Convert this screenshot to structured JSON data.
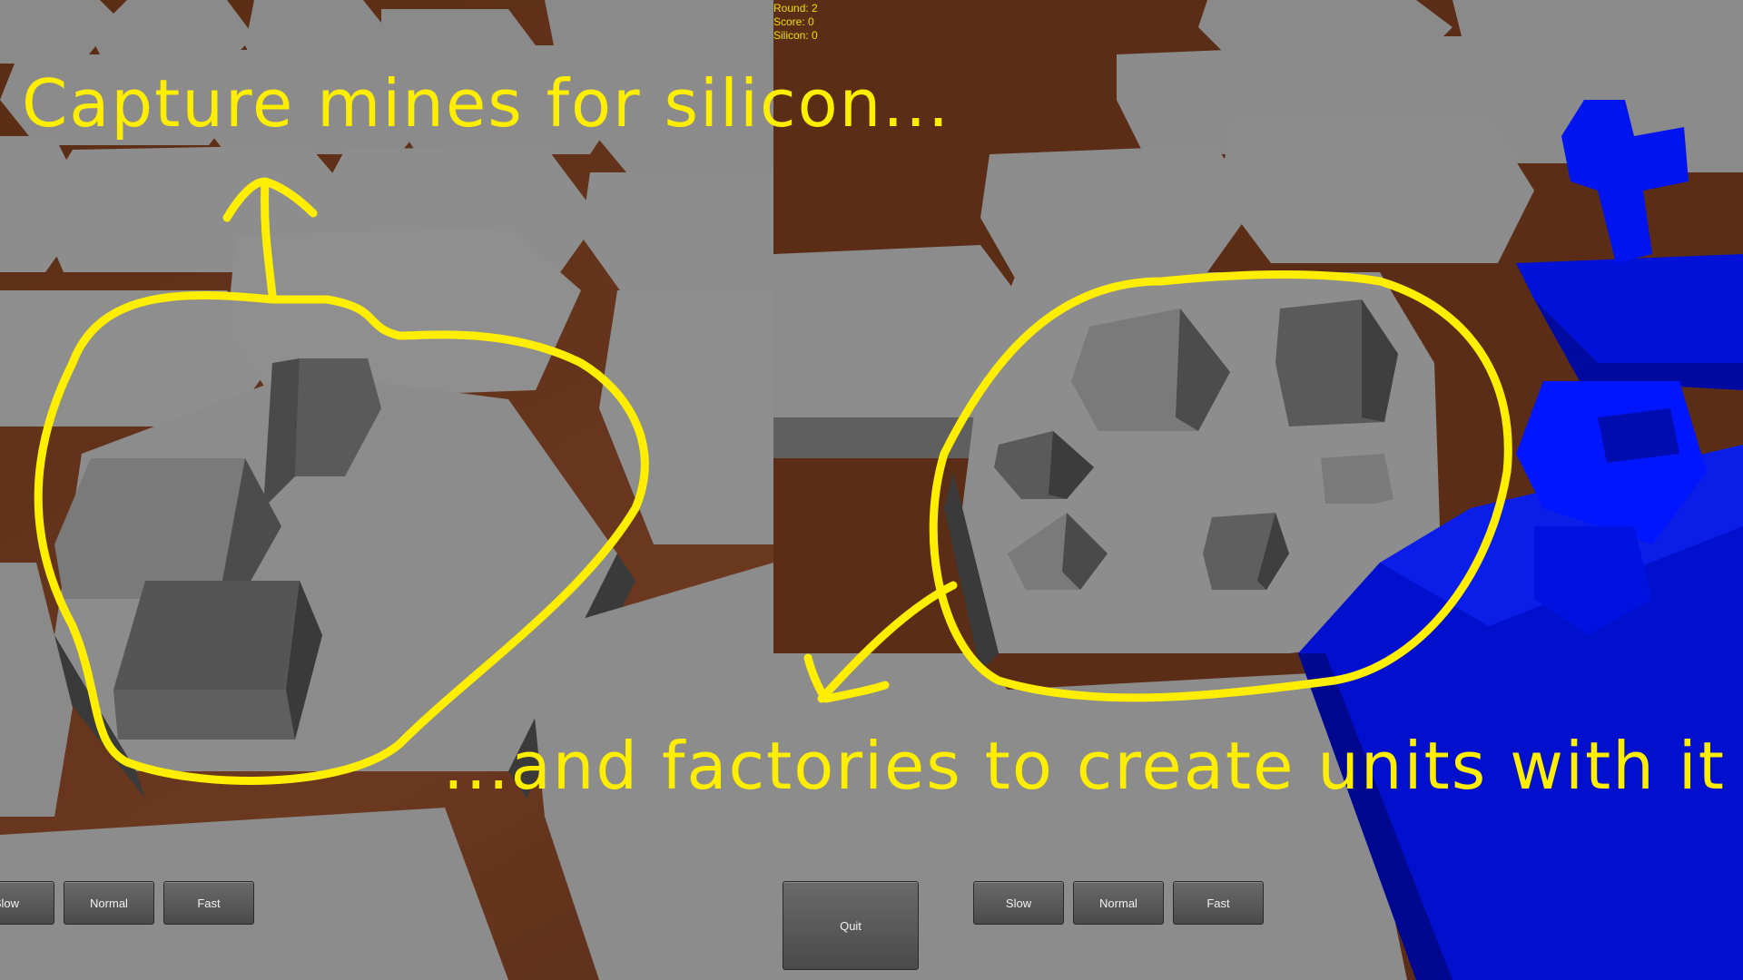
{
  "hud": {
    "round": "Round: 2",
    "score": "Score: 0",
    "silicon": "Silicon: 0"
  },
  "captions": {
    "top": "Capture mines for silicon...",
    "bottom": "...and factories to create units with it"
  },
  "left_controls": {
    "slow": "Slow",
    "normal": "Normal",
    "fast": "Fast"
  },
  "right_controls": {
    "quit": "Quit",
    "slow": "Slow",
    "normal": "Normal",
    "fast": "Fast"
  },
  "colors": {
    "annotation": "#ffee00",
    "unit": "#0010ee",
    "tile": "#8c8c8c",
    "ground": "#5a2e16"
  }
}
